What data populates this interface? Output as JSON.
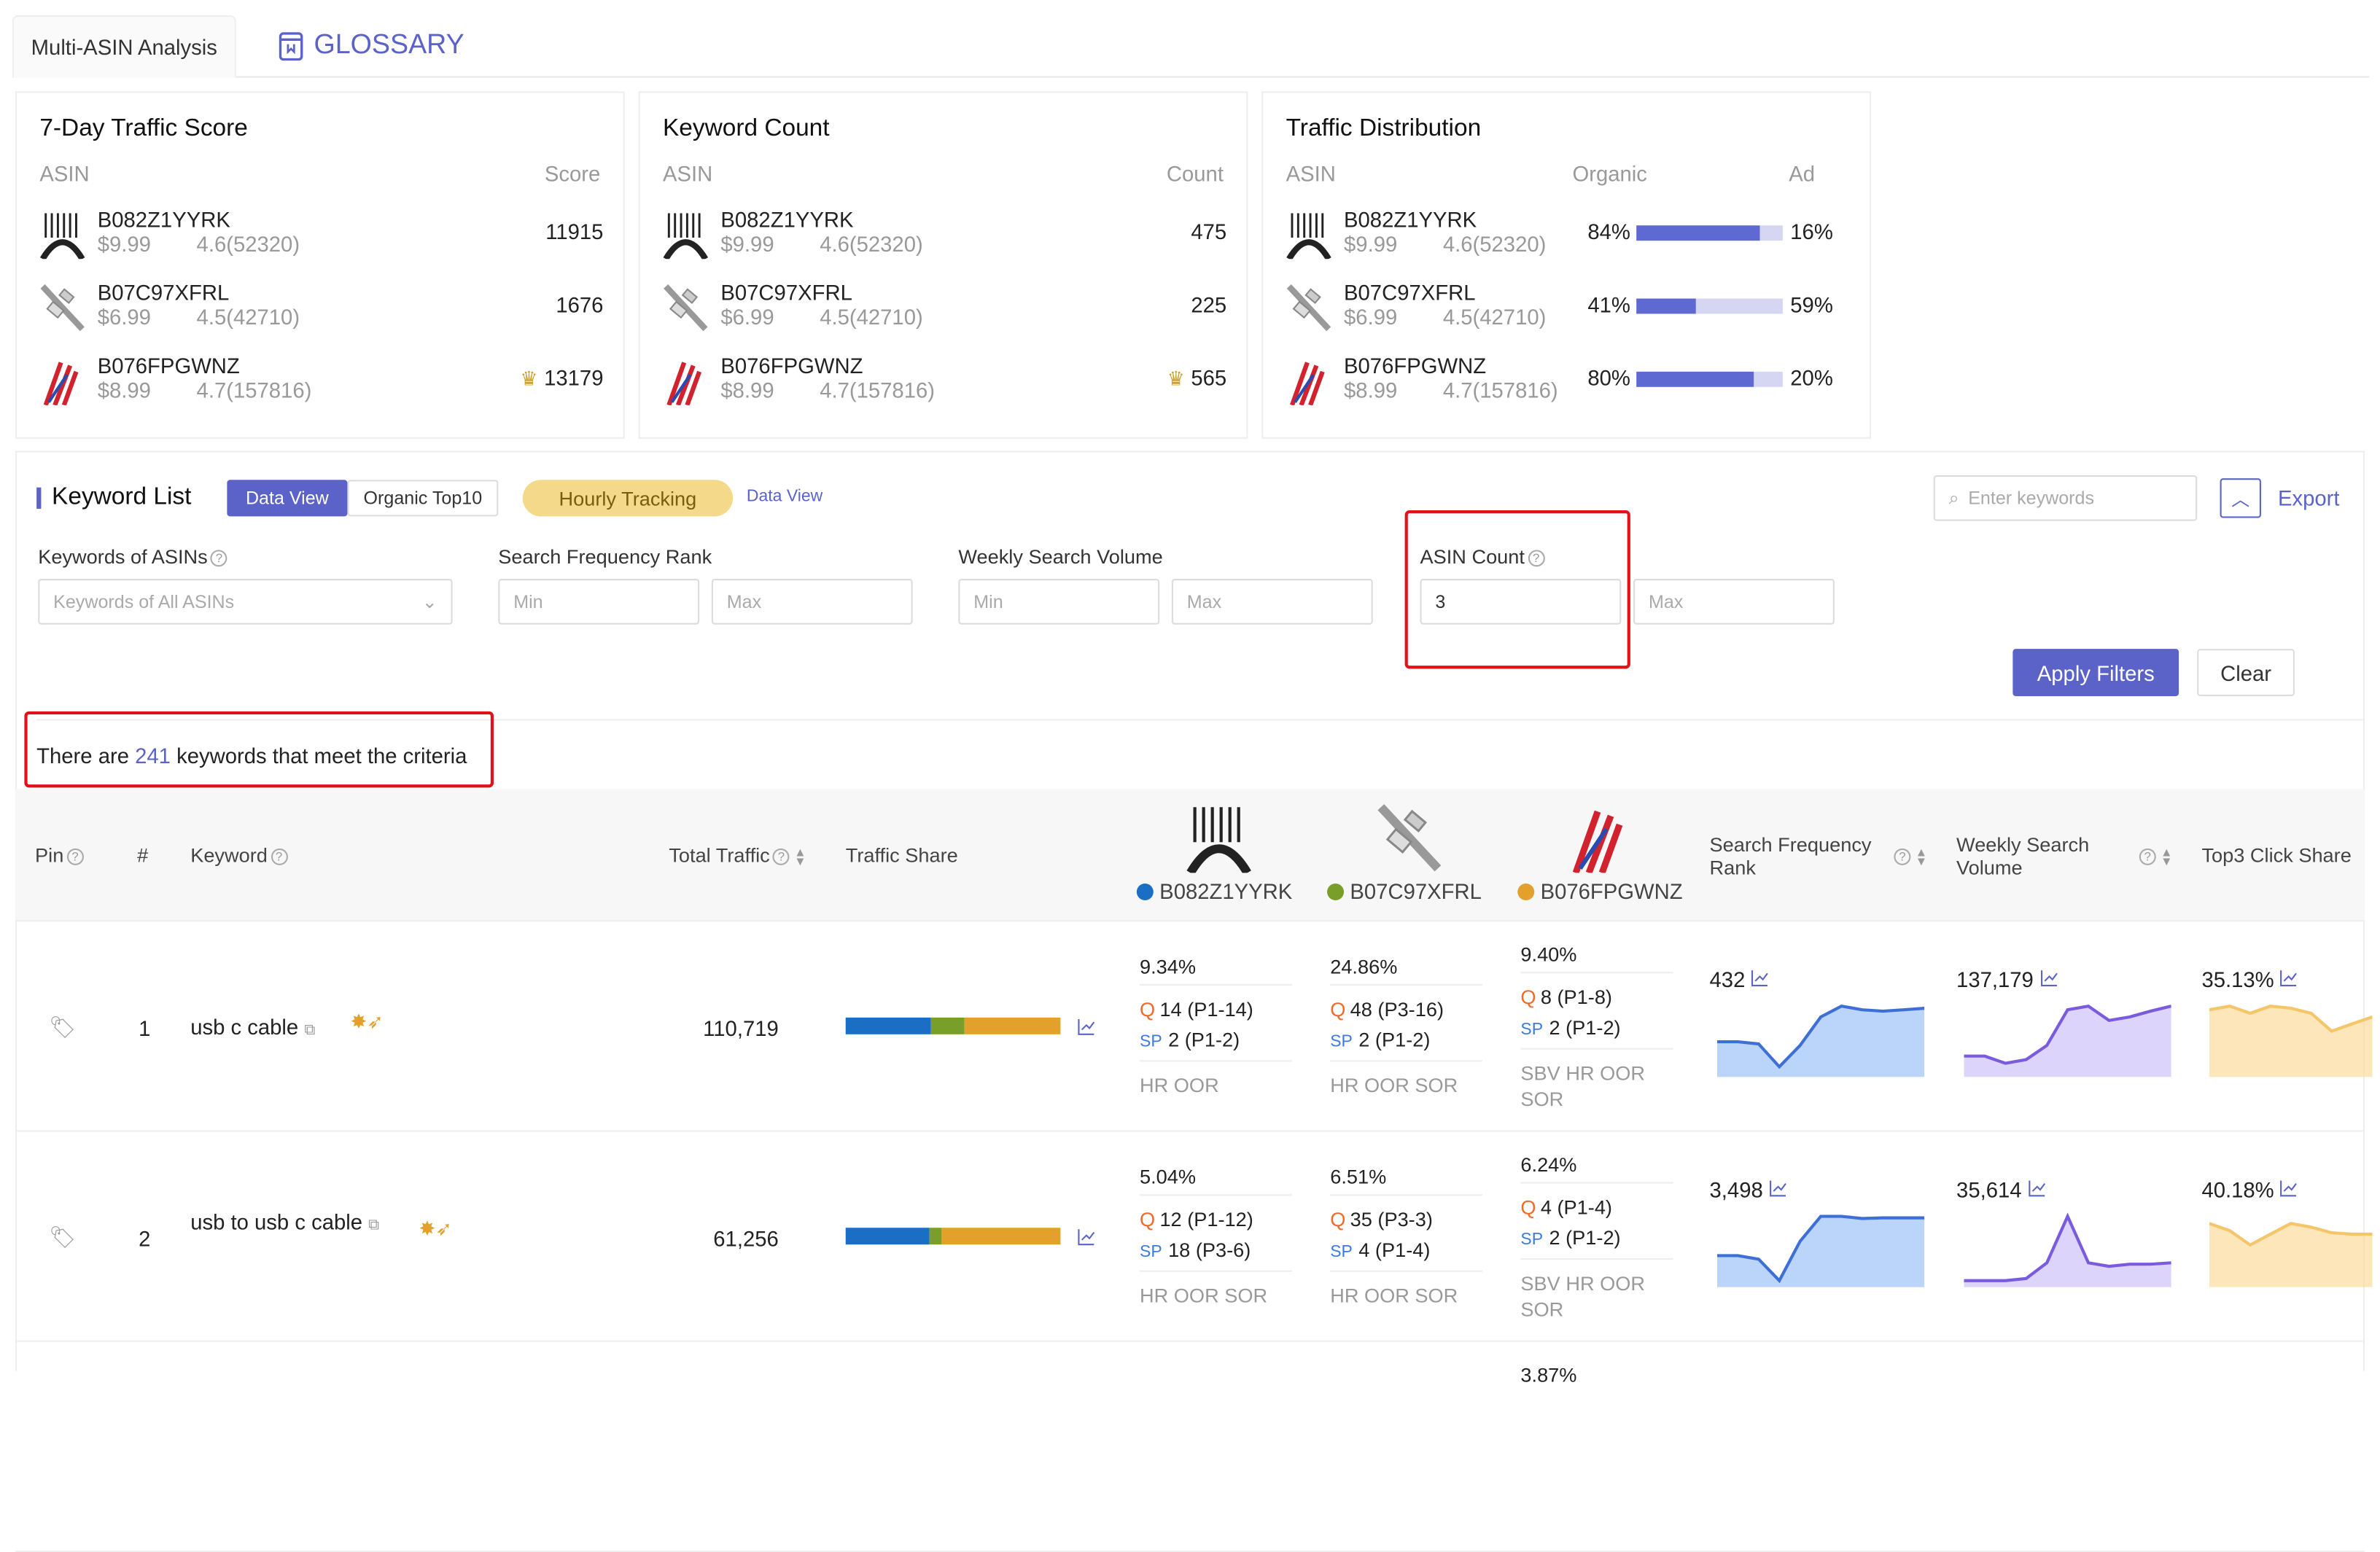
{
  "tabs": {
    "active": "Multi-ASIN Analysis",
    "glossary": "GLOSSARY"
  },
  "colors": {
    "accent": "#5b63c9",
    "asin1": "#1a6fc4",
    "asin2": "#7a9e2a",
    "asin3": "#e3a02a",
    "highlight": "#e3101a",
    "crown": "#c9a030"
  },
  "traffic_score": {
    "title": "7-Day Traffic Score",
    "col_asin": "ASIN",
    "col_value": "Score",
    "rows": [
      {
        "asin": "B082Z1YYRK",
        "price": "$9.99",
        "rating": "4.6(52320)",
        "value": "11915",
        "crown": false
      },
      {
        "asin": "B07C97XFRL",
        "price": "$6.99",
        "rating": "4.5(42710)",
        "value": "1676",
        "crown": false
      },
      {
        "asin": "B076FPGWNZ",
        "price": "$8.99",
        "rating": "4.7(157816)",
        "value": "13179",
        "crown": true
      }
    ]
  },
  "keyword_count": {
    "title": "Keyword Count",
    "col_asin": "ASIN",
    "col_value": "Count",
    "rows": [
      {
        "asin": "B082Z1YYRK",
        "price": "$9.99",
        "rating": "4.6(52320)",
        "value": "475",
        "crown": false
      },
      {
        "asin": "B07C97XFRL",
        "price": "$6.99",
        "rating": "4.5(42710)",
        "value": "225",
        "crown": false
      },
      {
        "asin": "B076FPGWNZ",
        "price": "$8.99",
        "rating": "4.7(157816)",
        "value": "565",
        "crown": true
      }
    ]
  },
  "traffic_distribution": {
    "title": "Traffic Distribution",
    "col_asin": "ASIN",
    "col_organic": "Organic",
    "col_ad": "Ad",
    "rows": [
      {
        "asin": "B082Z1YYRK",
        "price": "$9.99",
        "rating": "4.6(52320)",
        "organic": "84%",
        "ad": "16%",
        "organic_fraction": 0.84
      },
      {
        "asin": "B07C97XFRL",
        "price": "$6.99",
        "rating": "4.5(42710)",
        "organic": "41%",
        "ad": "59%",
        "organic_fraction": 0.41
      },
      {
        "asin": "B076FPGWNZ",
        "price": "$8.99",
        "rating": "4.7(157816)",
        "organic": "80%",
        "ad": "20%",
        "organic_fraction": 0.8
      }
    ]
  },
  "keyword_list": {
    "title": "Keyword List",
    "view_tabs": [
      "Data View",
      "Organic Top10"
    ],
    "active_view": "Data View",
    "hourly": "Hourly Tracking",
    "search_placeholder": "Enter keywords",
    "export": "Export",
    "filters": {
      "keywords_of_asins": {
        "label": "Keywords of ASINs",
        "value": "Keywords of All ASINs"
      },
      "search_freq_rank": {
        "label": "Search Frequency Rank",
        "min": "Min",
        "max": "Max"
      },
      "weekly_search_volume": {
        "label": "Weekly Search Volume",
        "min": "Min",
        "max": "Max"
      },
      "asin_count": {
        "label": "ASIN Count",
        "min_value": "3",
        "max": "Max"
      }
    },
    "apply": "Apply Filters",
    "clear": "Clear",
    "criteria": {
      "prefix": "There are ",
      "count": "241",
      "suffix": " keywords that meet the criteria"
    }
  },
  "table": {
    "headers": {
      "pin": "Pin",
      "num": "#",
      "keyword": "Keyword",
      "total_traffic": "Total Traffic",
      "traffic_share": "Traffic Share",
      "asin1": "B082Z1YYRK",
      "asin2": "B07C97XFRL",
      "asin3": "B076FPGWNZ",
      "sfr": "Search Frequency Rank",
      "wsv": "Weekly Search Volume",
      "top3": "Top3 Click Share"
    },
    "rows": [
      {
        "num": "1",
        "keyword": "usb c cable",
        "total_traffic": "110,719",
        "share": [
          0.4,
          0.15,
          0.45
        ],
        "asins": [
          {
            "pct": "9.34%",
            "organic": "14 (P1-14)",
            "sp": "2 (P1-2)",
            "tags": "HR OOR"
          },
          {
            "pct": "24.86%",
            "organic": "48 (P3-16)",
            "sp": "2 (P1-2)",
            "tags": "HR OOR SOR"
          },
          {
            "pct": "9.40%",
            "organic": "8 (P1-8)",
            "sp": "2 (P1-2)",
            "tags": "SBV HR OOR SOR"
          }
        ],
        "sfr": "432",
        "wsv": "137,179",
        "top3": "35.13%",
        "trend_sfr": [
          0.45,
          0.45,
          0.42,
          0.1,
          0.4,
          0.8,
          0.95,
          0.9,
          0.88,
          0.9,
          0.92
        ],
        "trend_wsv": [
          0.25,
          0.25,
          0.15,
          0.2,
          0.4,
          0.9,
          0.95,
          0.75,
          0.8,
          0.88,
          0.95
        ],
        "trend_top3": [
          0.9,
          0.95,
          0.85,
          0.95,
          0.92,
          0.85,
          0.6,
          0.7,
          0.8
        ]
      },
      {
        "num": "2",
        "keyword": "usb to usb c cable",
        "total_traffic": "61,256",
        "share": [
          0.39,
          0.06,
          0.55
        ],
        "asins": [
          {
            "pct": "5.04%",
            "organic": "12 (P1-12)",
            "sp": "18 (P3-6)",
            "tags": "HR OOR SOR"
          },
          {
            "pct": "6.51%",
            "organic": "35 (P3-3)",
            "sp": "4 (P1-4)",
            "tags": "HR OOR SOR"
          },
          {
            "pct": "6.24%",
            "organic": "4 (P1-4)",
            "sp": "2 (P1-2)",
            "tags": "SBV HR OOR SOR"
          }
        ],
        "sfr": "3,498",
        "wsv": "35,614",
        "top3": "40.18%",
        "trend_sfr": [
          0.4,
          0.4,
          0.35,
          0.05,
          0.6,
          0.95,
          0.95,
          0.92,
          0.93,
          0.93,
          0.93
        ],
        "trend_wsv": [
          0.05,
          0.05,
          0.05,
          0.08,
          0.3,
          0.95,
          0.3,
          0.25,
          0.28,
          0.28,
          0.3
        ],
        "trend_top3": [
          0.85,
          0.75,
          0.55,
          0.7,
          0.85,
          0.8,
          0.72,
          0.7,
          0.7
        ]
      },
      {
        "asins": [
          {},
          {},
          {
            "pct": "3.87%"
          }
        ]
      }
    ]
  }
}
